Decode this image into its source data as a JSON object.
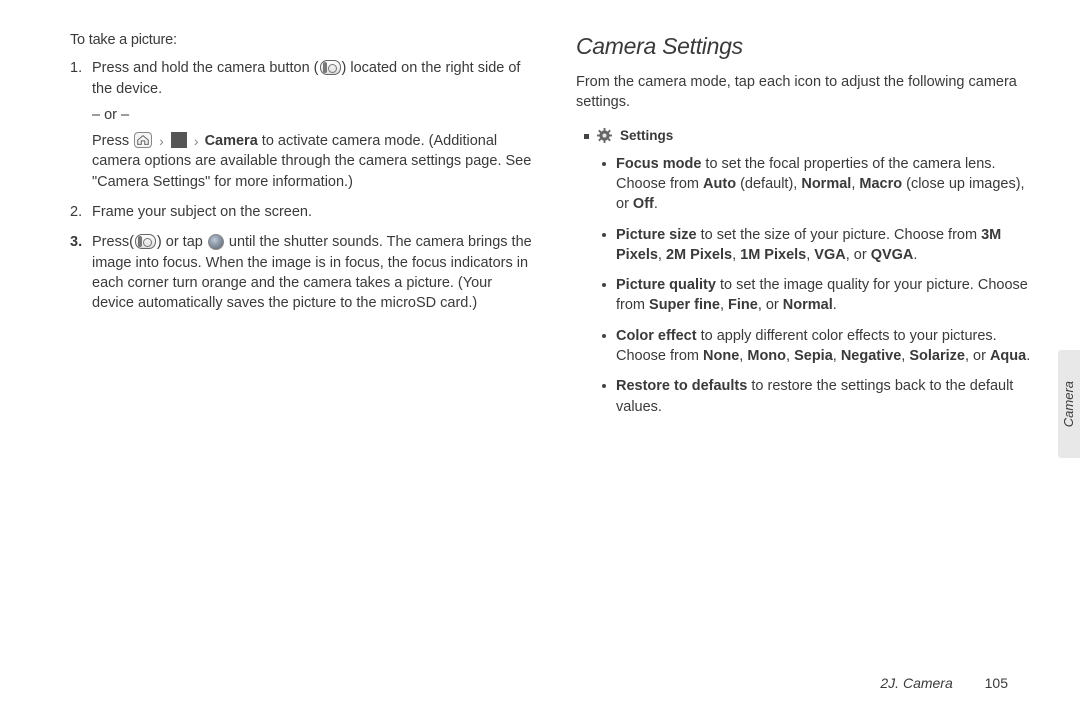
{
  "left": {
    "intro": "To take a picture:",
    "steps": [
      {
        "num": "1.",
        "pre": "Press and hold the camera button (",
        "post": ") located on the right side of the device.",
        "or": "– or –",
        "alt_pre": "Press ",
        "alt_mid": " to activate camera mode. (Additional camera options are available through the camera settings page. See \"Camera Settings\" for more information.)",
        "camera_word": "Camera"
      },
      {
        "num": "2.",
        "text": "Frame your subject on the screen."
      },
      {
        "num": "3.",
        "pre": "Press(",
        "mid1": ") or tap ",
        "post": " until the shutter sounds. The camera brings the image into focus. When the image is in focus, the focus indicators in each corner turn orange and the camera takes a picture. (Your device automatically saves the picture to the microSD card.)"
      }
    ]
  },
  "right": {
    "heading": "Camera Settings",
    "intro": "From the camera mode, tap each icon to adjust the following camera settings.",
    "settings_label": "Settings",
    "items": [
      {
        "lead": "Focus mode",
        "text_a": " to set the focal properties of the camera lens. Choose from ",
        "b1": "Auto",
        "text_b": " (default), ",
        "b2": "Normal",
        "text_c": ", ",
        "b3": "Macro",
        "text_d": " (close up images), or ",
        "b4": "Off",
        "tail": "."
      },
      {
        "lead": "Picture size",
        "text_a": " to set the size of your picture. Choose from ",
        "b1": "3M Pixels",
        "text_b": ", ",
        "b2": "2M Pixels",
        "text_c": ", ",
        "b3": "1M Pixels",
        "text_d": ", ",
        "b4": "VGA",
        "text_e": ", or ",
        "b5": "QVGA",
        "tail": "."
      },
      {
        "lead": "Picture quality",
        "text_a": " to set the image quality for your picture. Choose from ",
        "b1": "Super fine",
        "text_b": ", ",
        "b2": "Fine",
        "text_c": ", or ",
        "b3": "Normal",
        "tail": "."
      },
      {
        "lead": "Color effect",
        "text_a": " to apply different color effects to your pictures. Choose from ",
        "b1": "None",
        "text_b": ", ",
        "b2": "Mono",
        "text_c": ", ",
        "b3": "Sepia",
        "text_d": ", ",
        "b4": "Negative",
        "text_e": ", ",
        "b5": "Solarize",
        "text_f": ", or ",
        "b6": "Aqua",
        "tail": "."
      },
      {
        "lead": "Restore to defaults",
        "text_a": " to restore the settings back to the default values.",
        "tail": ""
      }
    ]
  },
  "sidetab": "Camera",
  "footer_section": "2J. Camera",
  "footer_page": "105"
}
